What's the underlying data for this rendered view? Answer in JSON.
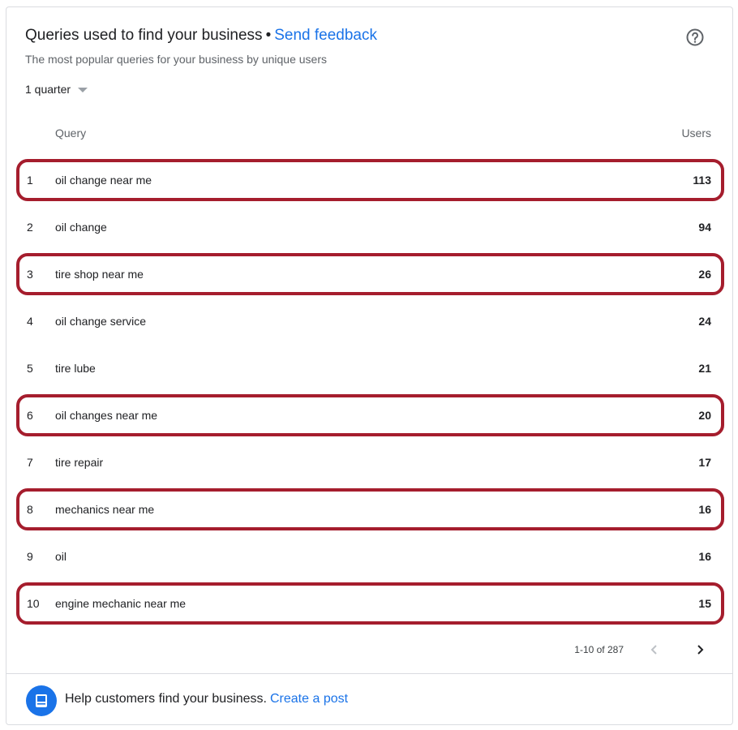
{
  "header": {
    "title": "Queries used to find your business",
    "separator": "•",
    "feedback_link": "Send feedback",
    "subtitle": "The most popular queries for your business by unique users"
  },
  "filter": {
    "period": "1 quarter"
  },
  "table": {
    "columns": {
      "query": "Query",
      "users": "Users"
    },
    "rows": [
      {
        "rank": "1",
        "query": "oil change near me",
        "users": "113",
        "highlighted": true
      },
      {
        "rank": "2",
        "query": "oil change",
        "users": "94",
        "highlighted": false
      },
      {
        "rank": "3",
        "query": "tire shop near me",
        "users": "26",
        "highlighted": true
      },
      {
        "rank": "4",
        "query": "oil change service",
        "users": "24",
        "highlighted": false
      },
      {
        "rank": "5",
        "query": "tire lube",
        "users": "21",
        "highlighted": false
      },
      {
        "rank": "6",
        "query": "oil changes near me",
        "users": "20",
        "highlighted": true
      },
      {
        "rank": "7",
        "query": "tire repair",
        "users": "17",
        "highlighted": false
      },
      {
        "rank": "8",
        "query": "mechanics near me",
        "users": "16",
        "highlighted": true
      },
      {
        "rank": "9",
        "query": "oil",
        "users": "16",
        "highlighted": false
      },
      {
        "rank": "10",
        "query": "engine mechanic near me",
        "users": "15",
        "highlighted": true
      }
    ]
  },
  "pagination": {
    "range": "1-10 of 287"
  },
  "footer": {
    "text": "Help customers find your business.",
    "link": "Create a post"
  },
  "icons": {
    "help": "help-circle-icon",
    "dropdown": "caret-down-icon",
    "prev": "chevron-left-icon",
    "next": "chevron-right-icon",
    "post": "post-icon"
  },
  "colors": {
    "link": "#1a73e8",
    "highlight": "#a51d2d",
    "muted": "#5f6368"
  }
}
